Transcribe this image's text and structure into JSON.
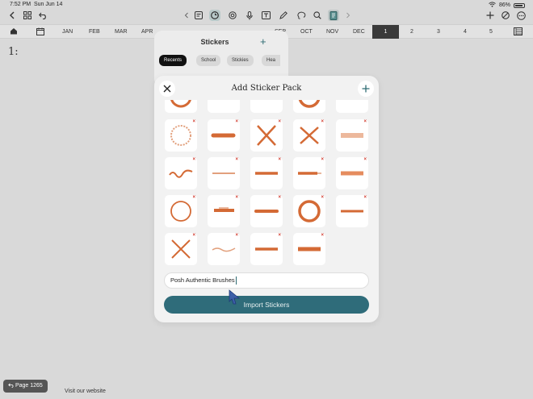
{
  "status": {
    "time": "7:52 PM",
    "date": "Sun Jun 14",
    "battery": "86%"
  },
  "months": [
    "JAN",
    "FEB",
    "MAR",
    "APR",
    "SEP",
    "OCT",
    "NOV",
    "DEC"
  ],
  "weeks": [
    "1",
    "2",
    "3",
    "4",
    "5"
  ],
  "page_number": "1:",
  "stickers_panel": {
    "title": "Stickers",
    "tabs": [
      "Recents",
      "School",
      "Stickies",
      "Hea"
    ]
  },
  "dialog": {
    "title": "Add Sticker Pack",
    "pack_name": "Posh Authentic Brushes",
    "import_label": "Import Stickers"
  },
  "accent": "#2f6c7a",
  "sticker_color": "#d46a35",
  "footer": {
    "page_label": "Page 1265",
    "visit_label": "Visit our website"
  }
}
